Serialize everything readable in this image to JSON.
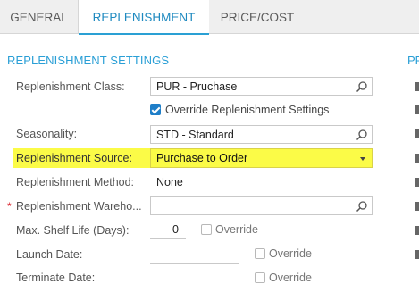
{
  "tabs": [
    {
      "label": "GENERAL"
    },
    {
      "label": "REPLENISHMENT"
    },
    {
      "label": "PRICE/COST"
    }
  ],
  "section": {
    "title": "REPLENISHMENT SETTINGS",
    "right_title_partial": "PR"
  },
  "fields": {
    "replenishment_class": {
      "label": "Replenishment Class:",
      "value": "PUR - Pruchase"
    },
    "override_settings": {
      "label": "Override Replenishment Settings",
      "checked": true
    },
    "seasonality": {
      "label": "Seasonality:",
      "value": "STD - Standard"
    },
    "replenishment_source": {
      "label": "Replenishment Source:",
      "value": "Purchase to Order"
    },
    "replenishment_method": {
      "label": "Replenishment Method:",
      "value": "None"
    },
    "replenishment_warehouse": {
      "label": "Replenishment Wareho...",
      "value": "",
      "required": "*"
    },
    "max_shelf_life": {
      "label": "Max. Shelf Life (Days):",
      "value": "0",
      "override_label": "Override"
    },
    "launch_date": {
      "label": "Launch Date:",
      "value": "",
      "override_label": "Override"
    },
    "next_row_partial": {
      "label": "Terminate Date:",
      "override_label": "Override"
    }
  },
  "colors": {
    "accent": "#2a9fd6",
    "highlight": "#fbfb47",
    "required": "#d9232d"
  }
}
